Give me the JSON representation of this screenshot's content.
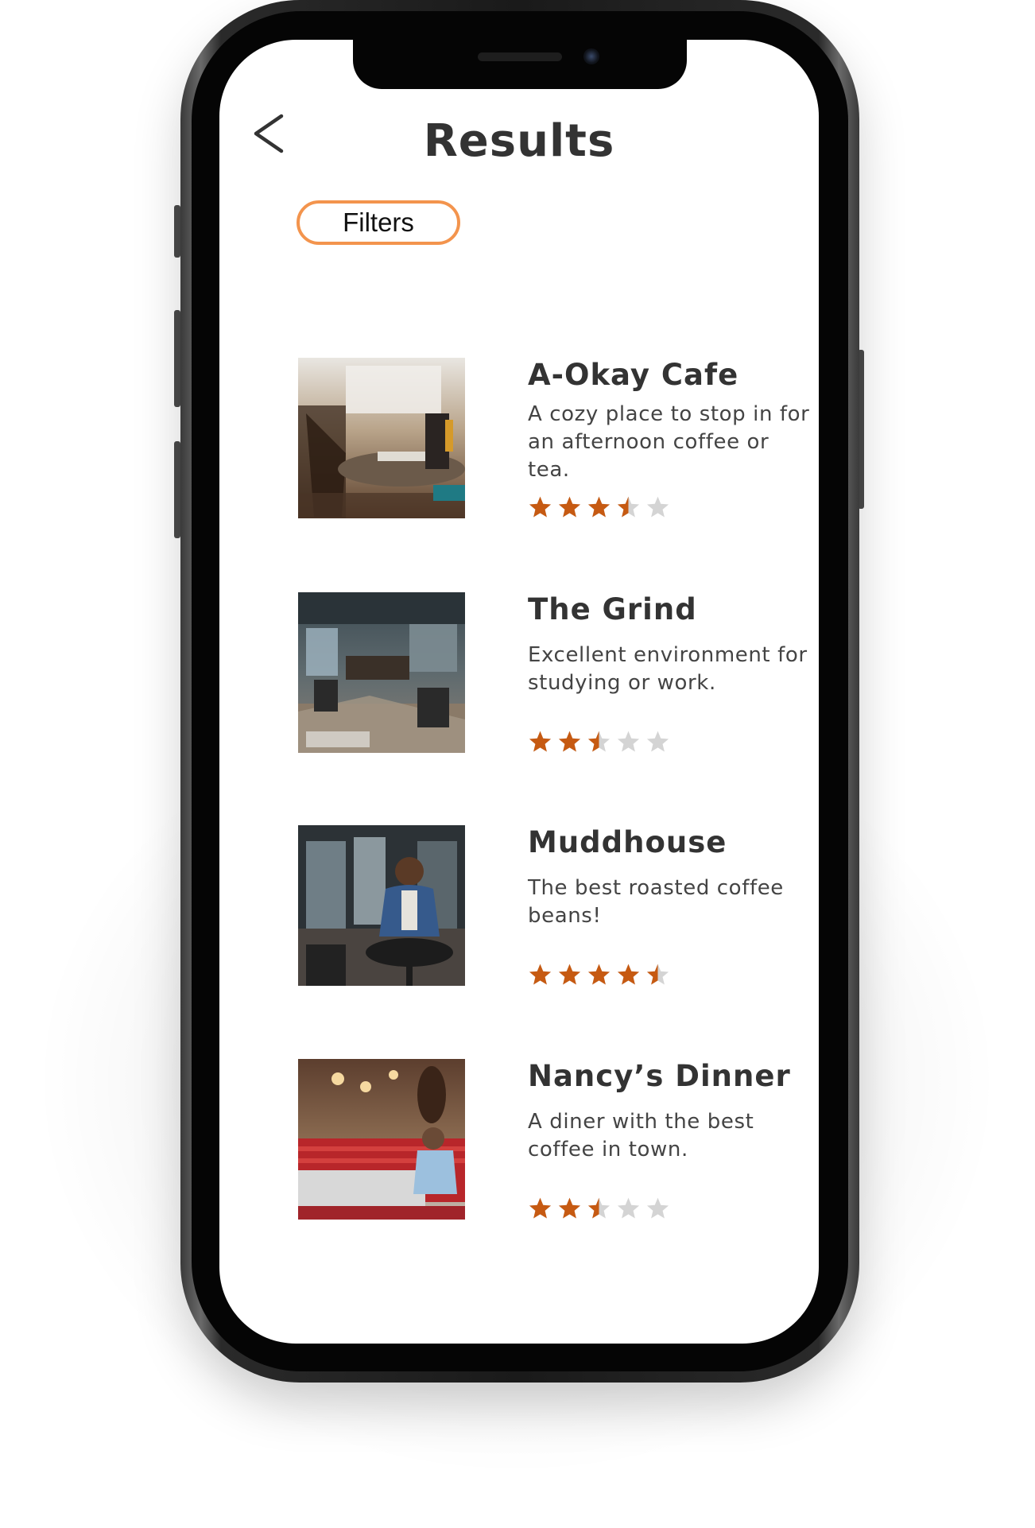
{
  "header": {
    "title": "Results",
    "back_icon": "chevron-left-icon"
  },
  "filters": {
    "label": "Filters",
    "border_color": "#f3944d"
  },
  "colors": {
    "star_filled": "#c65a12",
    "star_empty": "#d4d4d4",
    "text": "#333333"
  },
  "results": [
    {
      "name": "A-Okay Cafe",
      "description": "A cozy place to stop in for an afternoon coffee or tea.",
      "rating": 3.5,
      "rating_max": 5
    },
    {
      "name": "The Grind",
      "description": "Excellent environment for studying or work.",
      "rating": 2.5,
      "rating_max": 5
    },
    {
      "name": "Muddhouse",
      "description": "The best roasted coffee beans!",
      "rating": 4.5,
      "rating_max": 5
    },
    {
      "name": "Nancy’s Dinner",
      "description": "A diner with the best coffee in town.",
      "rating": 2.5,
      "rating_max": 5
    }
  ]
}
